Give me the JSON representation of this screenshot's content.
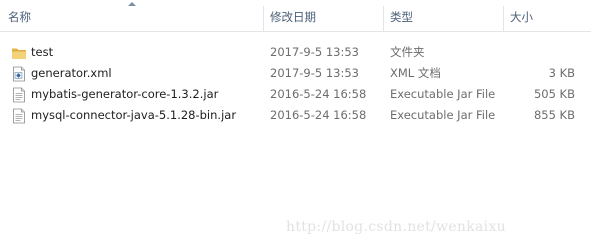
{
  "columns": {
    "name": "名称",
    "date": "修改日期",
    "type": "类型",
    "size": "大小"
  },
  "files": [
    {
      "name": "test",
      "date": "2017-9-5 13:53",
      "type": "文件夹",
      "size": "",
      "icon": "folder-icon"
    },
    {
      "name": "generator.xml",
      "date": "2017-9-5 13:53",
      "type": "XML 文档",
      "size": "3 KB",
      "icon": "xml-file-icon"
    },
    {
      "name": "mybatis-generator-core-1.3.2.jar",
      "date": "2016-5-24 16:58",
      "type": "Executable Jar File",
      "size": "505 KB",
      "icon": "jar-file-icon"
    },
    {
      "name": "mysql-connector-java-5.1.28-bin.jar",
      "date": "2016-5-24 16:58",
      "type": "Executable Jar File",
      "size": "855 KB",
      "icon": "jar-file-icon"
    }
  ],
  "watermark": "http://blog.csdn.net/wenkaixu",
  "colors": {
    "header_text": "#4c607a",
    "folder": "#e8c15a",
    "secondary_text": "#6d6d6d"
  }
}
